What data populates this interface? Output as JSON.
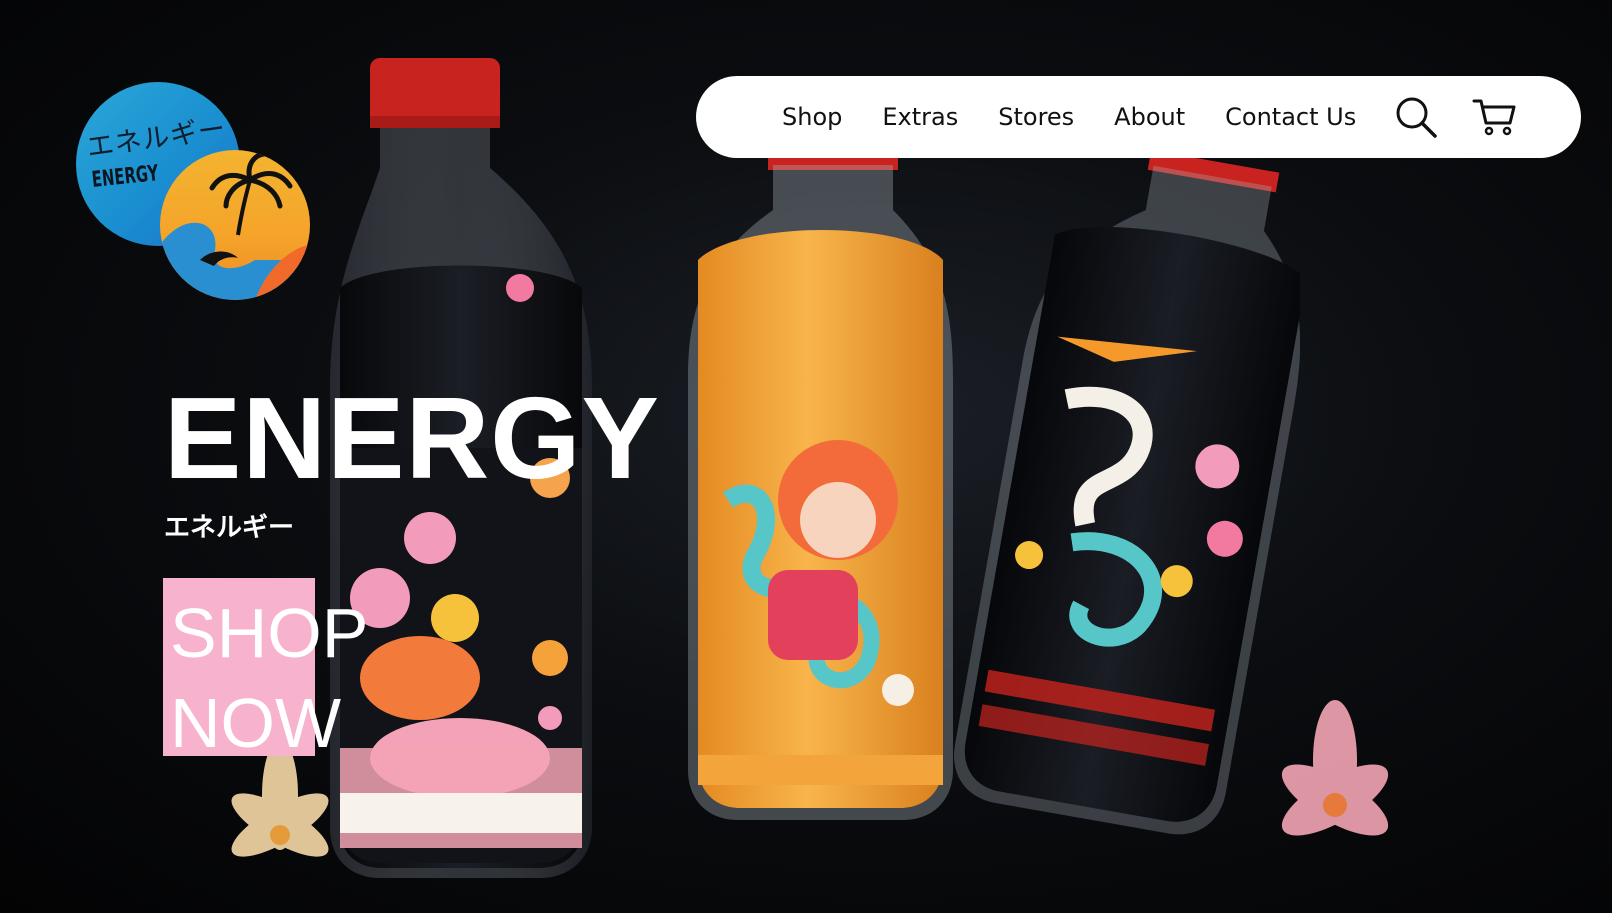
{
  "logo": {
    "jp_text": "エネルギー",
    "en_text": "ENERGY"
  },
  "nav": {
    "links": [
      "Shop",
      "Extras",
      "Stores",
      "About",
      "Contact Us"
    ],
    "search_icon": "search-icon",
    "cart_icon": "cart-icon"
  },
  "hero": {
    "title": "ENERGY",
    "subtitle": "エネルギー",
    "cta_label": "SHOP NOW"
  },
  "colors": {
    "cta_background": "#f7b3cd",
    "nav_background": "#ffffff",
    "page_background": "#0b0d10",
    "cap_red": "#c8231e",
    "orange_bottle": "#f3a43a"
  }
}
